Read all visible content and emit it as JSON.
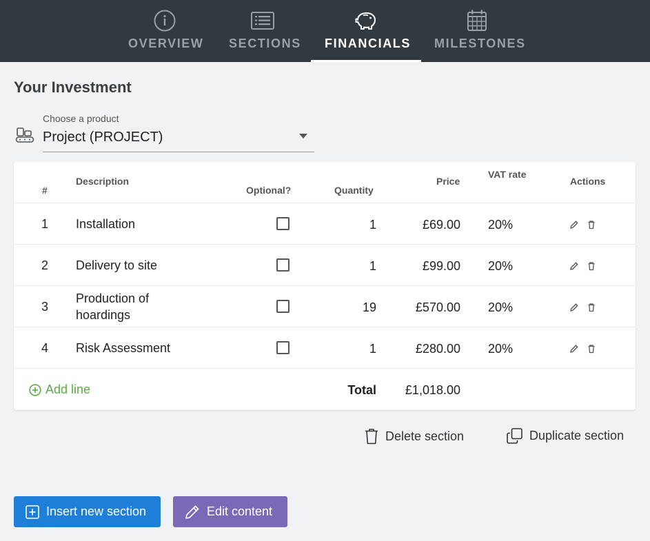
{
  "nav": {
    "tabs": [
      {
        "label": "OVERVIEW",
        "icon": "info-icon"
      },
      {
        "label": "SECTIONS",
        "icon": "list-icon"
      },
      {
        "label": "FINANCIALS",
        "icon": "piggy-bank-icon",
        "active": true
      },
      {
        "label": "MILESTONES",
        "icon": "calendar-icon"
      }
    ]
  },
  "investment": {
    "title": "Your Investment",
    "product_label": "Choose a product",
    "product_value": "Project (PROJECT)"
  },
  "table": {
    "headers": {
      "num": "#",
      "description": "Description",
      "optional": "Optional?",
      "quantity": "Quantity",
      "price": "Price",
      "vat": "VAT rate",
      "actions": "Actions"
    },
    "rows": [
      {
        "num": "1",
        "description": "Installation",
        "quantity": "1",
        "price": "£69.00",
        "vat": "20%"
      },
      {
        "num": "2",
        "description": "Delivery to site",
        "quantity": "1",
        "price": "£99.00",
        "vat": "20%"
      },
      {
        "num": "3",
        "description": "Production of hoardings",
        "quantity": "19",
        "price": "£570.00",
        "vat": "20%"
      },
      {
        "num": "4",
        "description": "Risk Assessment",
        "quantity": "1",
        "price": "£280.00",
        "vat": "20%"
      }
    ],
    "add_line": "Add line",
    "total_label": "Total",
    "total_value": "£1,018.00"
  },
  "section_actions": {
    "delete": "Delete section",
    "duplicate": "Duplicate section"
  },
  "buttons": {
    "insert": "Insert new section",
    "edit": "Edit content"
  },
  "colors": {
    "nav_bg": "#333a3f",
    "accent_green": "#5aab45",
    "button_blue": "#1f7fd8",
    "button_purple": "#7b69b8"
  }
}
